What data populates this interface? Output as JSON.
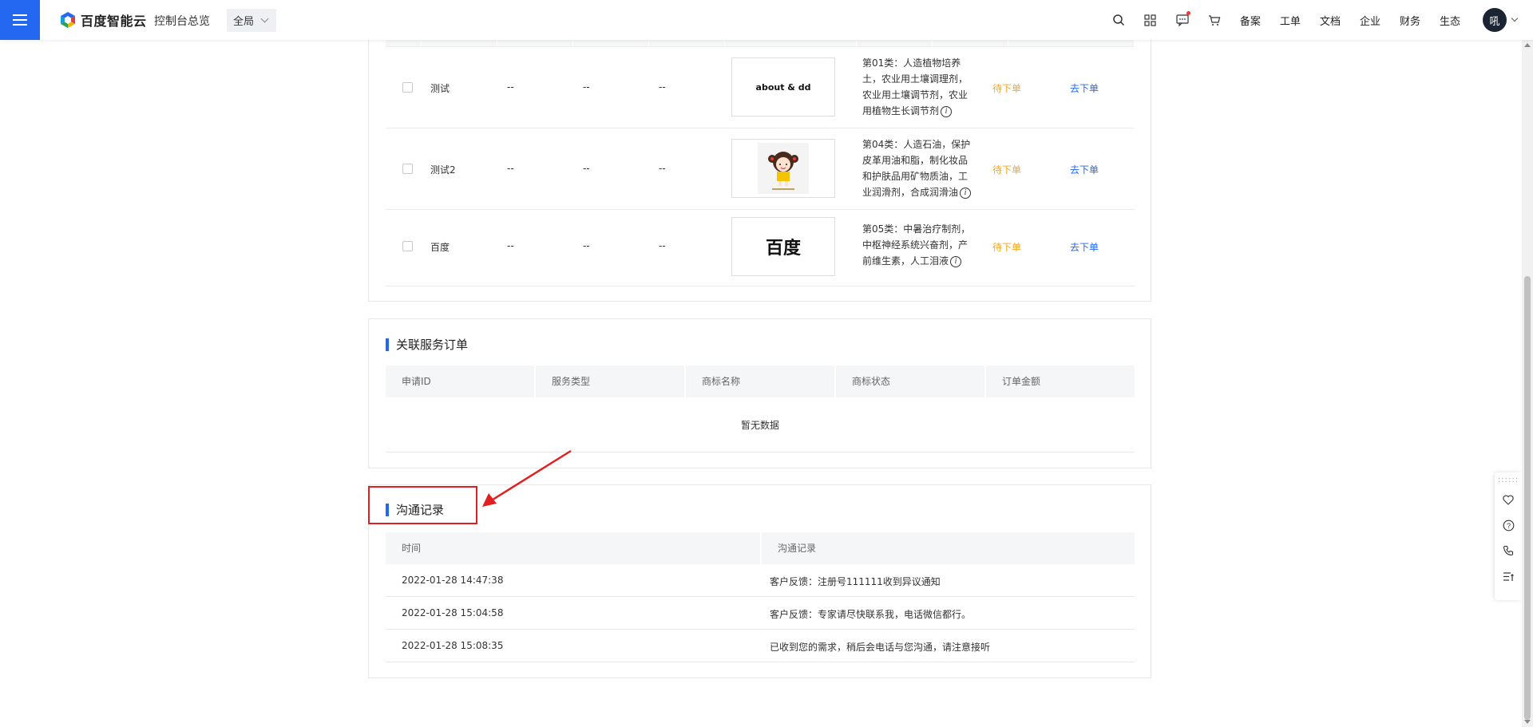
{
  "topbar": {
    "logo_text": "百度智能云",
    "console_link": "控制台总览",
    "region": "全局",
    "nav_items": [
      "备案",
      "工单",
      "文档",
      "企业",
      "财务",
      "生态"
    ],
    "avatar_text": "吼"
  },
  "trademark_rows": [
    {
      "name": "测试",
      "c1": "--",
      "c2": "--",
      "c3": "--",
      "thumb_text": "about & dd",
      "category": "第01类：人造植物培养土，农业用土壤调理剂，农业用土壤调节剂，农业用植物生长调节剂",
      "status": "待下单",
      "action": "去下单"
    },
    {
      "name": "测试2",
      "c1": "--",
      "c2": "--",
      "c3": "--",
      "thumb_text": "",
      "category": "第04类：人造石油，保护皮革用油和脂，制化妆品和护肤品用矿物质油，工业润滑剂，合成润滑油",
      "status": "待下单",
      "action": "去下单"
    },
    {
      "name": "百度",
      "c1": "--",
      "c2": "--",
      "c3": "--",
      "thumb_text": "百度",
      "category": "第05类：中暑治疗制剂，中枢神经系统兴奋剂，产前维生素，人工泪液",
      "status": "待下单",
      "action": "去下单"
    }
  ],
  "service_orders": {
    "title": "关联服务订单",
    "columns": [
      "申请ID",
      "服务类型",
      "商标名称",
      "商标状态",
      "订单金额"
    ],
    "empty_text": "暂无数据"
  },
  "communication": {
    "title": "沟通记录",
    "columns": [
      "时间",
      "沟通记录"
    ],
    "rows": [
      {
        "time": "2022-01-28 14:47:38",
        "record": "客户反馈：注册号111111收到异议通知"
      },
      {
        "time": "2022-01-28 15:04:58",
        "record": "客户反馈：专家请尽快联系我，电话微信都行。"
      },
      {
        "time": "2022-01-28 15:08:35",
        "record": "已收到您的需求，稍后会电话与您沟通，请注意接听"
      }
    ]
  },
  "colors": {
    "accent": "#2468f2",
    "pending": "#f5a623",
    "annotation": "#e02020"
  },
  "icons": [
    "menu-icon",
    "search-icon",
    "apps-icon",
    "message-icon",
    "cart-icon",
    "favorite-icon",
    "help-icon",
    "phone-icon",
    "list-icon",
    "info-icon"
  ]
}
